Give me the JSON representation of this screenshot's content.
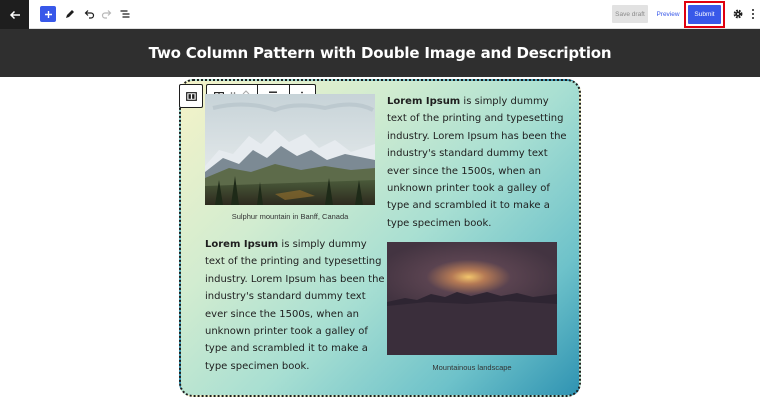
{
  "toolbar": {
    "save_draft_label": "Save draft",
    "preview_label": "Preview",
    "submit_label": "Submit",
    "accent_color": "#3858e9",
    "highlight_color": "#e0000f",
    "icons": [
      "back-arrow-icon",
      "plus-icon",
      "pencil-icon",
      "undo-icon",
      "redo-icon",
      "list-view-icon",
      "gear-icon",
      "more-vertical-icon"
    ]
  },
  "page": {
    "title": "Two Column Pattern with Double Image and Description"
  },
  "block_toolbar": {
    "icons": [
      "columns-icon",
      "columns-block-icon",
      "drag-handle-icon",
      "move-up-down-icon",
      "align-top-icon",
      "more-options-icon"
    ]
  },
  "content": {
    "col1_caption": "Sulphur mountain in Banff, Canada",
    "col1_paragraph": {
      "bold": "Lorem Ipsum",
      "rest": " is simply dummy text of the printing and typesetting industry. Lorem Ipsum has been the industry's standard dummy text ever since the 1500s, when an unknown printer took a galley of type and scrambled it to make a type specimen book."
    },
    "col2_paragraph": {
      "bold": "Lorem Ipsum",
      "rest": " is simply dummy text of the printing and typesetting industry. Lorem Ipsum has been the industry's standard dummy text ever since the 1500s, when an unknown printer took a galley of type and scrambled it to make a type specimen book."
    },
    "col2_caption": "Mountainous landscape"
  }
}
